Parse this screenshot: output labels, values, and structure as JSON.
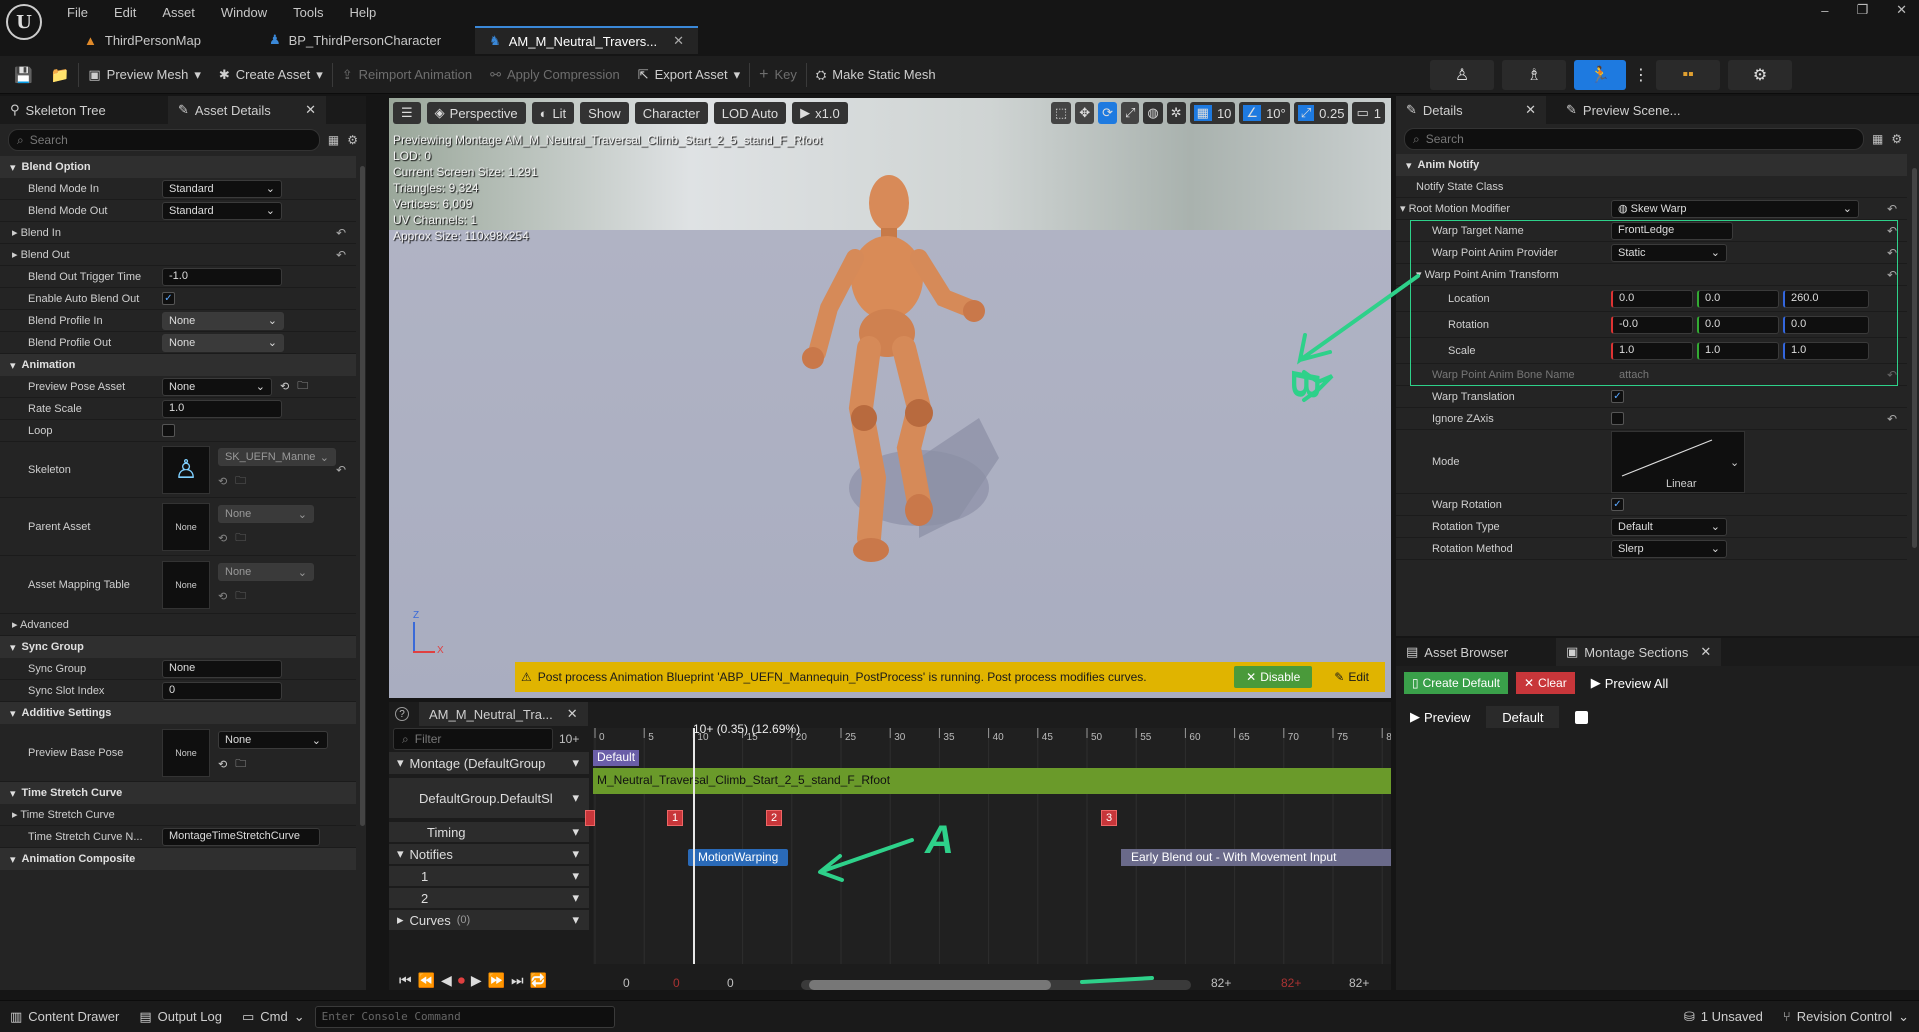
{
  "menu": [
    "File",
    "Edit",
    "Asset",
    "Window",
    "Tools",
    "Help"
  ],
  "doc_tabs": [
    {
      "label": "ThirdPersonMap"
    },
    {
      "label": "BP_ThirdPersonCharacter"
    },
    {
      "label": "AM_M_Neutral_Travers..."
    }
  ],
  "toolbar": {
    "preview_mesh": "Preview Mesh",
    "create_asset": "Create Asset",
    "reimport": "Reimport Animation",
    "apply_compression": "Apply Compression",
    "export_asset": "Export Asset",
    "key": "Key",
    "make_static_mesh": "Make Static Mesh"
  },
  "left": {
    "tab_skeleton": "Skeleton Tree",
    "tab_asset": "Asset Details",
    "search_placeholder": "Search",
    "cat_blend": "Blend Option",
    "blend_mode_in_l": "Blend Mode In",
    "blend_mode_in_v": "Standard",
    "blend_mode_out_l": "Blend Mode Out",
    "blend_mode_out_v": "Standard",
    "blend_in_l": "Blend In",
    "blend_out_l": "Blend Out",
    "blend_out_trigger_l": "Blend Out Trigger Time",
    "blend_out_trigger_v": "-1.0",
    "auto_blend_l": "Enable Auto Blend Out",
    "profile_in_l": "Blend Profile In",
    "profile_in_v": "None",
    "profile_out_l": "Blend Profile Out",
    "profile_out_v": "None",
    "cat_anim": "Animation",
    "pose_asset_l": "Preview Pose Asset",
    "pose_asset_v": "None",
    "rate_l": "Rate Scale",
    "rate_v": "1.0",
    "loop_l": "Loop",
    "skeleton_l": "Skeleton",
    "skeleton_v": "SK_UEFN_Manne",
    "parent_l": "Parent Asset",
    "parent_v": "None",
    "parent_thumb": "None",
    "mapping_l": "Asset Mapping Table",
    "mapping_v": "None",
    "mapping_thumb": "None",
    "advanced_l": "Advanced",
    "cat_sync": "Sync Group",
    "sync_group_l": "Sync Group",
    "sync_group_v": "None",
    "sync_slot_l": "Sync Slot Index",
    "sync_slot_v": "0",
    "cat_additive": "Additive Settings",
    "base_pose_l": "Preview Base Pose",
    "base_pose_v": "None",
    "base_pose_thumb": "None",
    "cat_time": "Time Stretch Curve",
    "tsc_l": "Time Stretch Curve",
    "tsc_name_l": "Time Stretch Curve N...",
    "tsc_name_v": "MontageTimeStretchCurve",
    "cat_composite": "Animation Composite"
  },
  "viewport": {
    "perspective": "Perspective",
    "lit": "Lit",
    "show": "Show",
    "character": "Character",
    "lod": "LOD Auto",
    "speed": "x1.0",
    "grid_val": "10",
    "angle_val": "10°",
    "scale_val": "0.25",
    "cam_val": "1",
    "info": [
      "Previewing Montage AM_M_Neutral_Traversal_Climb_Start_2_5_stand_F_Rfoot",
      "LOD: 0",
      "Current Screen Size: 1.291",
      "Triangles: 9,324",
      "Vertices: 6,009",
      "UV Channels: 1",
      "Approx Size: 110x98x254"
    ],
    "warning": "Post process Animation Blueprint 'ABP_UEFN_Mannequin_PostProcess' is running. Post process modifies curves.",
    "disable": "Disable",
    "edit": "Edit"
  },
  "timeline": {
    "tab": "AM_M_Neutral_Tra...",
    "filter": "Filter",
    "zoom": "10+",
    "playhead": "10+ (0.35) (12.69%)",
    "ticks": [
      "0",
      "5",
      "10",
      "15",
      "20",
      "25",
      "30",
      "35",
      "40",
      "45",
      "50",
      "55",
      "60",
      "65",
      "70",
      "75",
      "80"
    ],
    "montage": "Montage (DefaultGroup",
    "default": "Default",
    "slot": "DefaultGroup.DefaultSl",
    "clip": "M_Neutral_Traversal_Climb_Start_2_5_stand_F_Rfoot",
    "timing": "Timing",
    "notifies": "Notifies",
    "track1": "1",
    "track2": "2",
    "curves": "Curves",
    "curves_count": "(0)",
    "m1": "1",
    "m2": "2",
    "m3": "3",
    "notify_motion": "MotionWarping",
    "notify_blend": "Early Blend out - With Movement Input",
    "transport_nums": [
      "0",
      "0",
      "0",
      "82+",
      "82+",
      "82+"
    ],
    "scroll_fraction": 0.62
  },
  "details": {
    "tab": "Details",
    "tab2": "Preview Scene...",
    "search": "Search",
    "cat": "Anim Notify",
    "notify_state_l": "Notify State Class",
    "rmm_l": "Root Motion Modifier",
    "rmm_v": "Skew Warp",
    "warp_target_l": "Warp Target Name",
    "warp_target_v": "FrontLedge",
    "provider_l": "Warp Point Anim Provider",
    "provider_v": "Static",
    "transform_l": "Warp Point Anim Transform",
    "loc_l": "Location",
    "loc": [
      "0.0",
      "0.0",
      "260.0"
    ],
    "rot_l": "Rotation",
    "rot": [
      "-0.0",
      "0.0",
      "0.0"
    ],
    "scale_l": "Scale",
    "scale": [
      "1.0",
      "1.0",
      "1.0"
    ],
    "bone_l": "Warp Point Anim Bone Name",
    "bone_v": "attach",
    "translation_l": "Warp Translation",
    "ignore_z_l": "Ignore ZAxis",
    "mode_l": "Mode",
    "mode_v": "Linear",
    "warp_rot_l": "Warp Rotation",
    "rot_type_l": "Rotation Type",
    "rot_type_v": "Default",
    "rot_method_l": "Rotation Method",
    "rot_method_v": "Slerp"
  },
  "montage": {
    "tab_browser": "Asset Browser",
    "tab_sections": "Montage Sections",
    "create_default": "Create Default",
    "clear": "Clear",
    "preview_all": "Preview All",
    "preview": "Preview",
    "default": "Default"
  },
  "annotations": {
    "A": "A",
    "B": "B"
  },
  "status": {
    "content_drawer": "Content Drawer",
    "output_log": "Output Log",
    "cmd": "Cmd",
    "console_placeholder": "Enter Console Command",
    "unsaved": "1 Unsaved",
    "revision": "Revision Control"
  },
  "colors": {
    "accent": "#1e7ae0",
    "warning": "#e0b400",
    "annotation": "#2ed18a",
    "clip": "#6a9a2a"
  }
}
